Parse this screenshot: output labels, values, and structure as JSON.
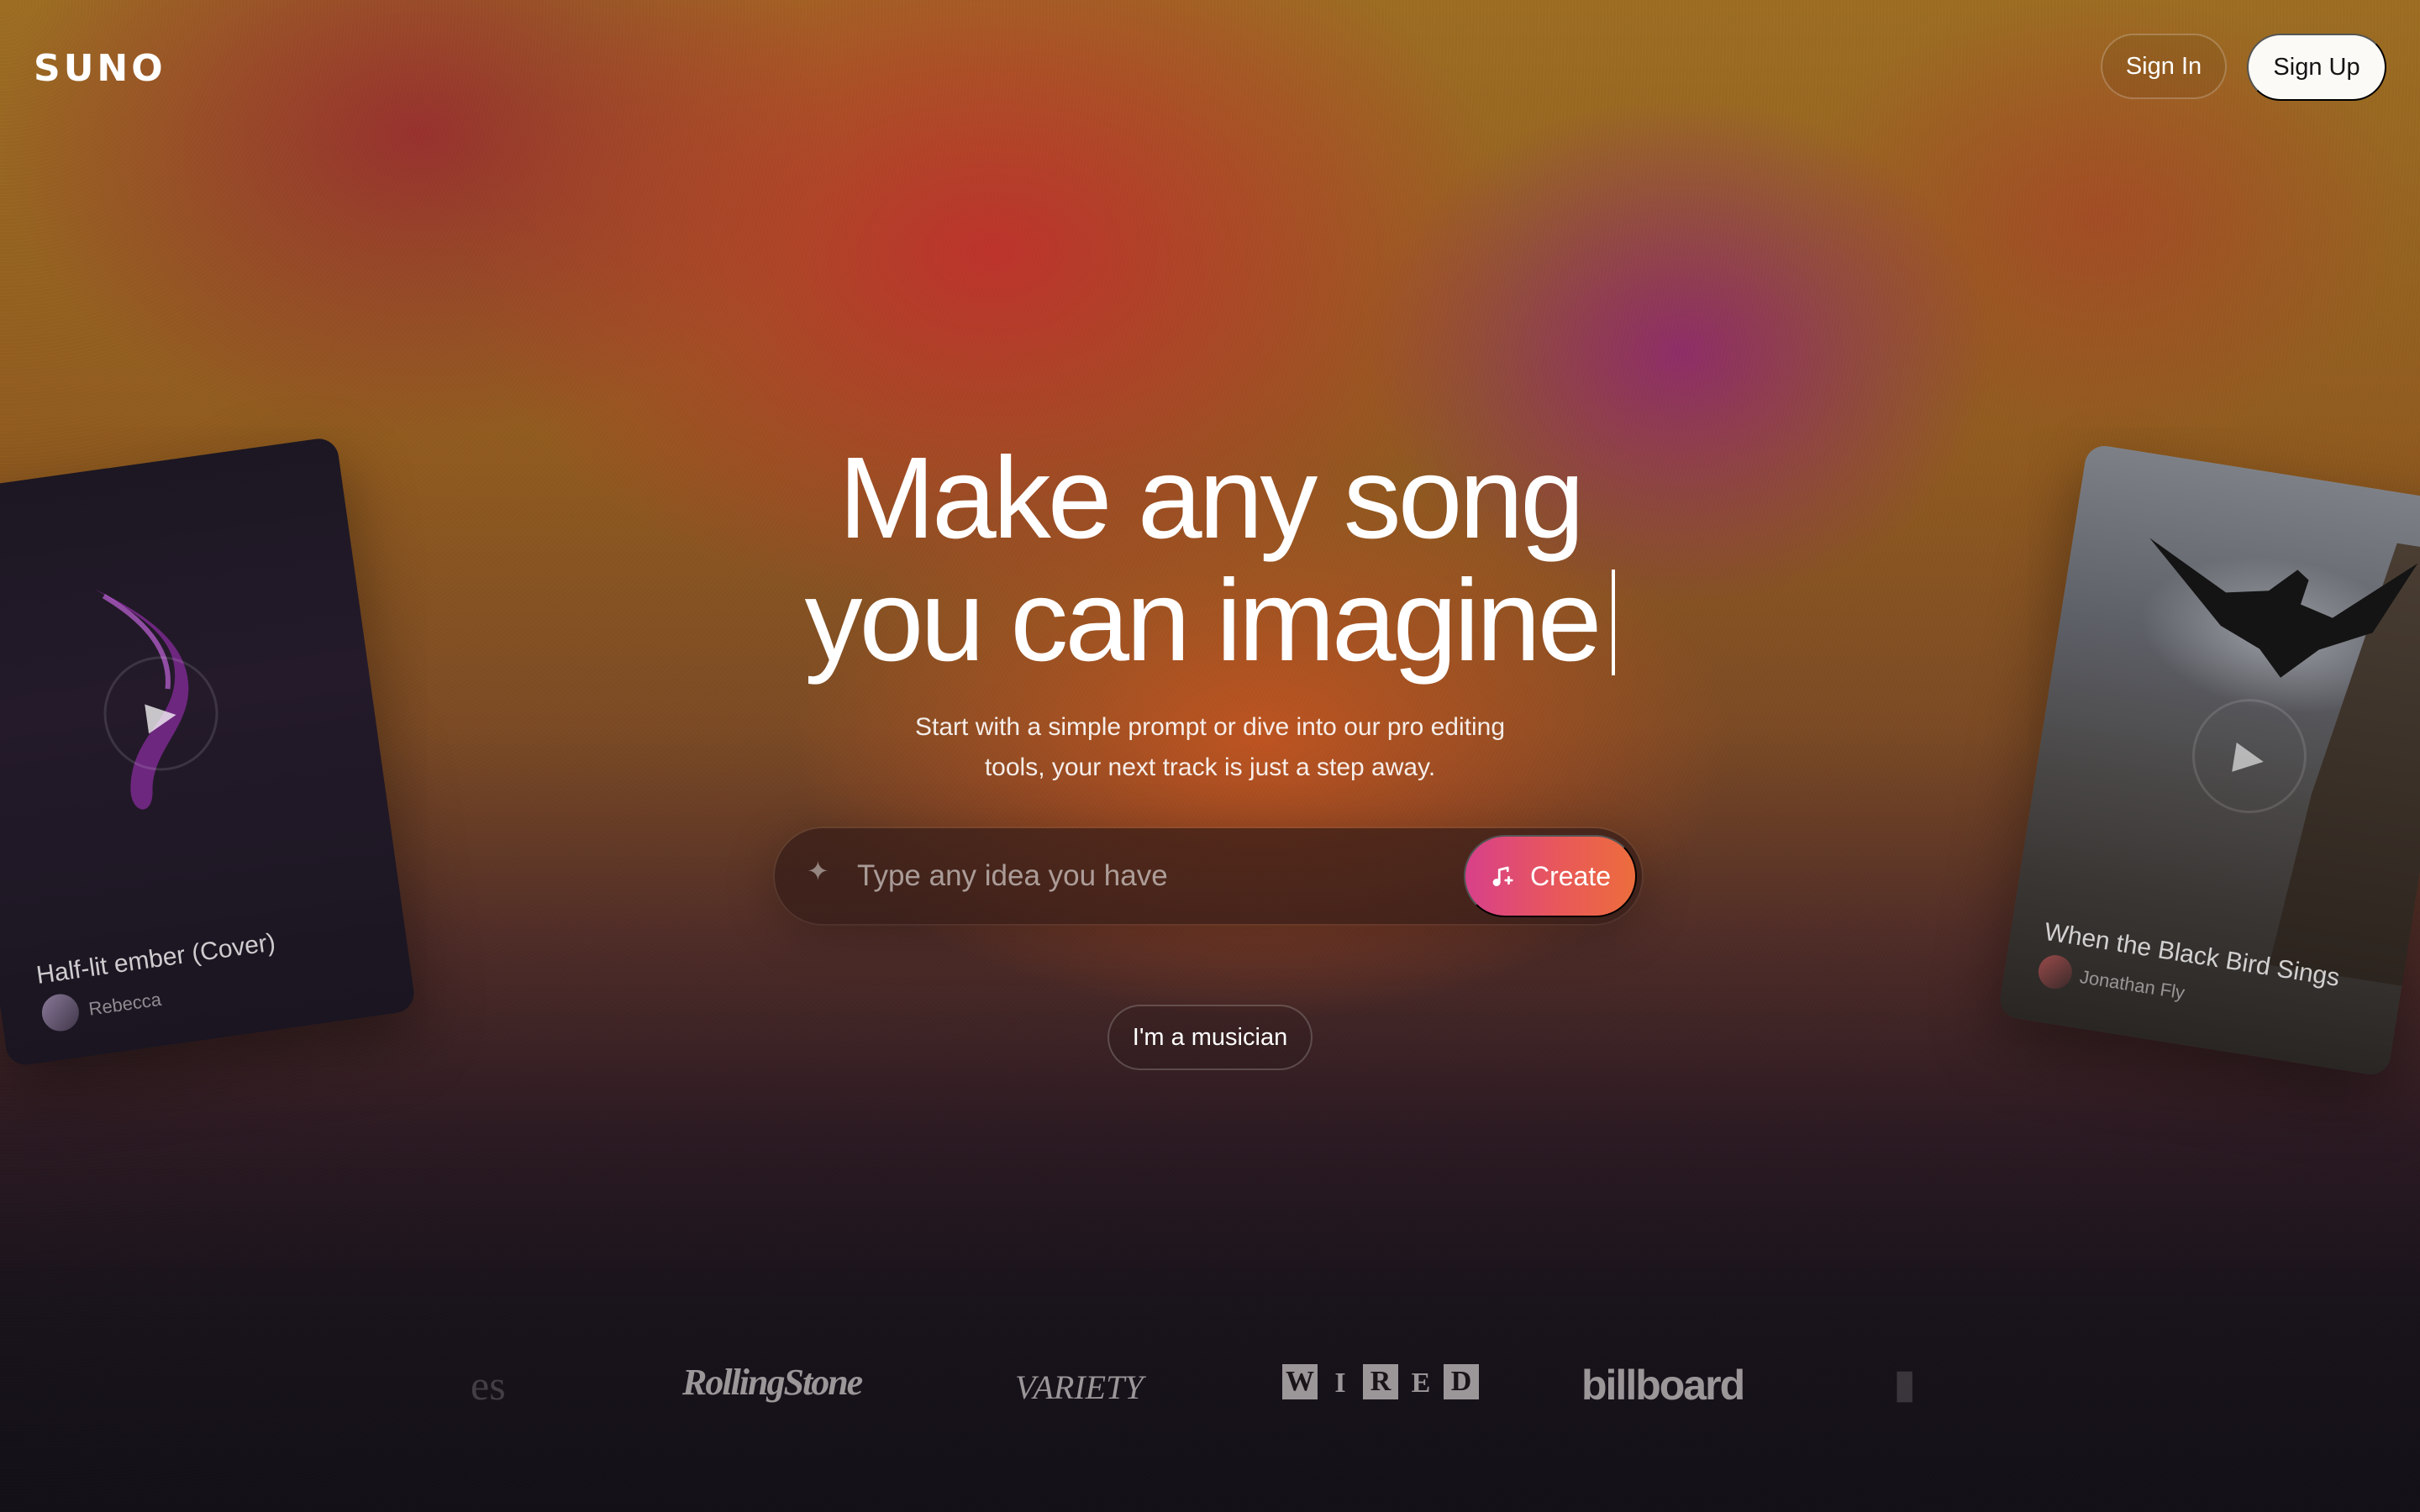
{
  "header": {
    "logo": "SUNO",
    "sign_in_label": "Sign In",
    "sign_up_label": "Sign Up"
  },
  "hero": {
    "title_line1": "Make any song",
    "title_line2": "you can imagine",
    "subtitle_line1": "Start with a simple prompt or dive into our pro editing",
    "subtitle_line2": "tools, your next track is just a step away."
  },
  "prompt": {
    "placeholder": "Type any idea you have",
    "value": "",
    "create_label": "Create",
    "sparkle_icon": "sparkle-icon",
    "create_icon": "music-note-icon"
  },
  "musician_label": "I'm a musician",
  "cards": {
    "left": {
      "title": "Half-lit ember (Cover)",
      "author": "Rebecca"
    },
    "right": {
      "title": "When the Black Bird Sings",
      "author": "Jonathan Fly"
    }
  },
  "press": {
    "forbes_partial": "es",
    "rolling_stone": "RollingStone",
    "variety": "VARIETY",
    "wired": [
      "W",
      "I",
      "R",
      "E",
      "D"
    ],
    "billboard": "billboard"
  },
  "colors": {
    "create_gradient_start": "#d8408a",
    "create_gradient_end": "#ed6d3c",
    "signup_bg": "#fbfaf7"
  }
}
